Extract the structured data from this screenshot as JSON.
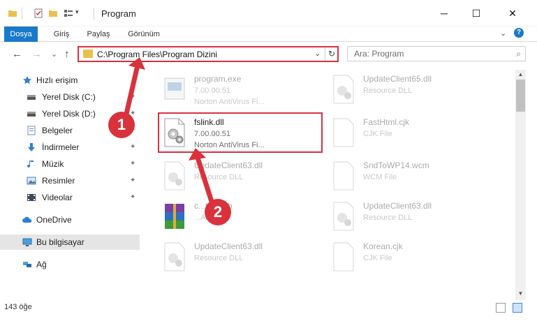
{
  "window": {
    "title": "Program",
    "minimize_glyph": "─",
    "maximize_glyph": "☐",
    "close_glyph": "✕"
  },
  "ribbon": {
    "tabs": [
      "Dosya",
      "Giriş",
      "Paylaş",
      "Görünüm"
    ],
    "active_tab": "Dosya",
    "collapse_glyph": "⌄",
    "help_glyph": "?",
    "accent_color": "#1979ca"
  },
  "nav": {
    "back_glyph": "←",
    "forward_glyph": "→",
    "recent_glyph": "⌄",
    "up_glyph": "↑",
    "address": "C:\\Program Files\\Program Dizini",
    "address_dropdown_glyph": "⌄",
    "refresh_glyph": "↻",
    "search_placeholder": "Ara: Program",
    "search_glyph": "⌕"
  },
  "sidebar": {
    "items": [
      {
        "label": "Hızlı erişim",
        "icon": "star-icon",
        "pinned": false
      },
      {
        "label": "Yerel Disk (C:)",
        "icon": "drive-icon",
        "pinned": true
      },
      {
        "label": "Yerel Disk (D:)",
        "icon": "drive-icon",
        "pinned": true
      },
      {
        "label": "Belgeler",
        "icon": "documents-icon",
        "pinned": true
      },
      {
        "label": "İndirmeler",
        "icon": "download-icon",
        "pinned": true
      },
      {
        "label": "Müzik",
        "icon": "music-icon",
        "pinned": true
      },
      {
        "label": "Resimler",
        "icon": "pictures-icon",
        "pinned": true
      },
      {
        "label": "Videolar",
        "icon": "videos-icon",
        "pinned": true
      },
      {
        "label": "OneDrive",
        "icon": "cloud-icon",
        "pinned": false
      },
      {
        "label": "Bu bilgisayar",
        "icon": "computer-icon",
        "pinned": false,
        "selected": true
      },
      {
        "label": "Ağ",
        "icon": "network-icon",
        "pinned": false
      }
    ],
    "pin_glyph": "📌"
  },
  "files": [
    {
      "name": "program.exe",
      "line2": "7.00.00.51",
      "line3": "Norton AntiVirus Fi...",
      "icon": "exe-icon",
      "faded": true
    },
    {
      "name": "UpdateClient65.dll",
      "line2": "Resource DLL",
      "line3": "",
      "icon": "dll-icon",
      "faded": true
    },
    {
      "name": "fslink.dll",
      "line2": "7.00.00.51",
      "line3": "Norton AntiVirus Fi...",
      "icon": "dll-icon",
      "faded": false
    },
    {
      "name": "FastHtml.cjk",
      "line2": "CJK File",
      "line3": "",
      "icon": "blank-file-icon",
      "faded": true
    },
    {
      "name": "UpdateClient63.dll",
      "line2": "Resource DLL",
      "line3": "",
      "icon": "dll-icon",
      "faded": true
    },
    {
      "name": "SndToWP14.wcm",
      "line2": "WCM File",
      "line3": "",
      "icon": "blank-file-icon",
      "faded": true
    },
    {
      "name": "c...tes.cab",
      "line2": "...Archive",
      "line3": "",
      "icon": "archive-icon",
      "faded": true
    },
    {
      "name": "UpdateClient63.dll",
      "line2": "Resource DLL",
      "line3": "",
      "icon": "dll-icon",
      "faded": true
    },
    {
      "name": "UpdateClient63.dll",
      "line2": "Resource DLL",
      "line3": "",
      "icon": "dll-icon",
      "faded": true
    },
    {
      "name": "Korean.cjk",
      "line2": "CJK File",
      "line3": "",
      "icon": "blank-file-icon",
      "faded": true
    }
  ],
  "status": {
    "item_count": "143 öğe"
  },
  "annotations": {
    "step1": "1",
    "step2": "2",
    "color": "#d9323c"
  }
}
